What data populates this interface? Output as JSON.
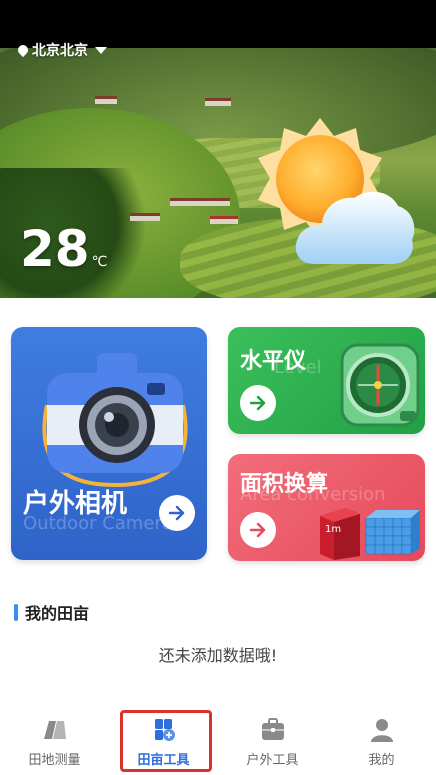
{
  "header": {
    "location": "北京北京",
    "temperature": "28",
    "temperature_unit": "℃",
    "weather_icon": "sun-behind-cloud-icon"
  },
  "tools": {
    "camera": {
      "title": "户外相机",
      "subtitle": "Outdoor Camera",
      "icon": "camera-icon",
      "color": "#2f63c8"
    },
    "level": {
      "title": "水平仪",
      "subtitle": "Level",
      "icon": "level-meter-icon",
      "color": "#22a044"
    },
    "area": {
      "title": "面积换算",
      "subtitle": "Area conversion",
      "icon": "cube-icon",
      "cube_label": "1m",
      "color": "#e54a5b"
    }
  },
  "my_fields": {
    "title": "我的田亩",
    "empty_message": "还未添加数据哦!"
  },
  "tabbar": {
    "active_index": 1,
    "accent": "#2f6fdc",
    "items": [
      {
        "label": "田地测量",
        "icon": "field-map-icon"
      },
      {
        "label": "田亩工具",
        "icon": "field-tools-icon"
      },
      {
        "label": "户外工具",
        "icon": "toolbox-icon"
      },
      {
        "label": "我的",
        "icon": "person-icon"
      }
    ]
  }
}
